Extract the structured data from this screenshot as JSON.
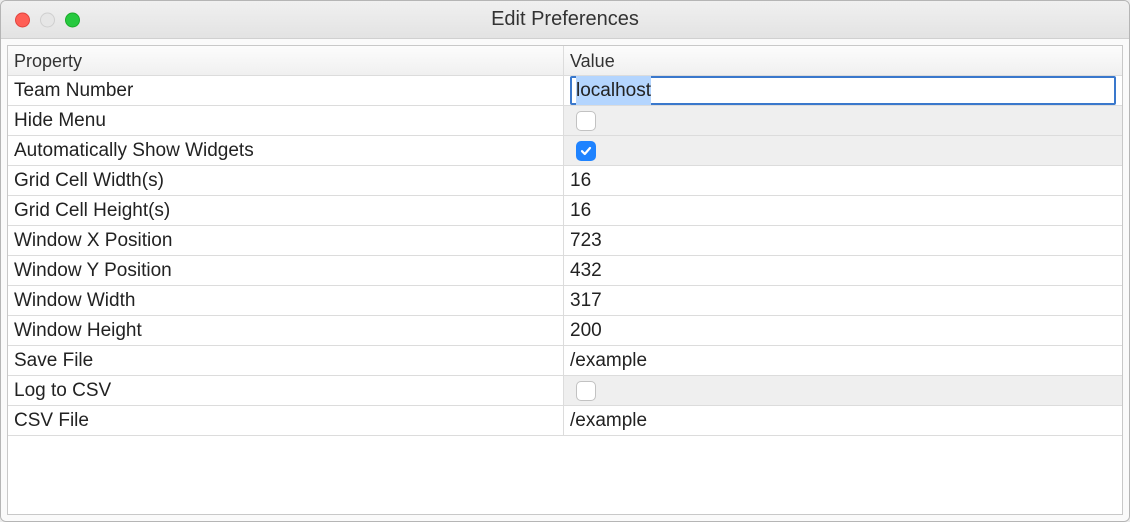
{
  "window_title": "Edit Preferences",
  "headers": {
    "property": "Property",
    "value": "Value"
  },
  "rows": [
    {
      "property": "Team Number",
      "type": "text_edit",
      "value": "localhost"
    },
    {
      "property": "Hide Menu",
      "type": "checkbox",
      "value": false
    },
    {
      "property": "Automatically Show Widgets",
      "type": "checkbox",
      "value": true
    },
    {
      "property": "Grid Cell Width(s)",
      "type": "text",
      "value": "16"
    },
    {
      "property": "Grid Cell Height(s)",
      "type": "text",
      "value": "16"
    },
    {
      "property": "Window X Position",
      "type": "text",
      "value": "723"
    },
    {
      "property": "Window Y Position",
      "type": "text",
      "value": "432"
    },
    {
      "property": "Window Width",
      "type": "text",
      "value": "317"
    },
    {
      "property": "Window Height",
      "type": "text",
      "value": "200"
    },
    {
      "property": "Save File",
      "type": "text",
      "value": "/example"
    },
    {
      "property": "Log to CSV",
      "type": "checkbox",
      "value": false
    },
    {
      "property": "CSV File",
      "type": "text",
      "value": "/example"
    }
  ]
}
